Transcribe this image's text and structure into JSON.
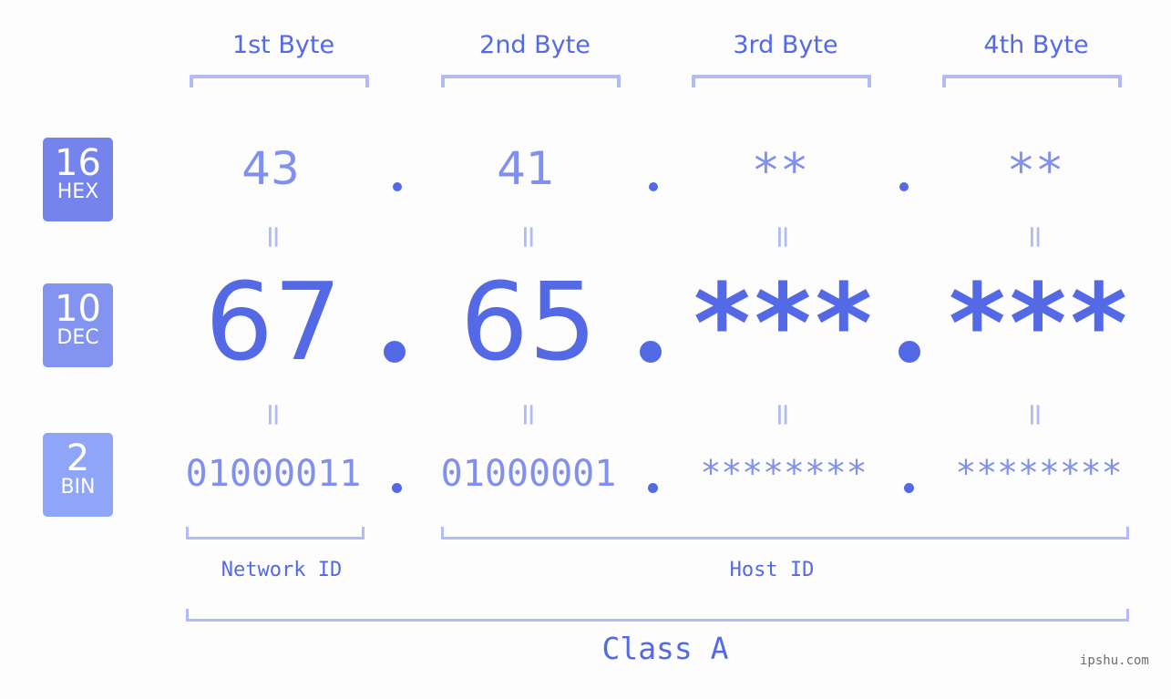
{
  "headers": [
    {
      "label": "1st Byte"
    },
    {
      "label": "2nd Byte"
    },
    {
      "label": "3rd Byte"
    },
    {
      "label": "4th Byte"
    }
  ],
  "badges": {
    "hex": {
      "num": "16",
      "label": "HEX",
      "color": "#7584ec"
    },
    "dec": {
      "num": "10",
      "label": "DEC",
      "color": "#8393f0"
    },
    "bin": {
      "num": "2",
      "label": "BIN",
      "color": "#8fa5f7"
    }
  },
  "hex_values": [
    "43",
    "41",
    "**",
    "**"
  ],
  "dec_values": [
    "67",
    "65",
    "***",
    "***"
  ],
  "bin_values": [
    "01000011",
    "01000001",
    "********",
    "********"
  ],
  "equals_sign": "=",
  "network_id_label": "Network ID",
  "host_id_label": "Host ID",
  "class_label": "Class A",
  "watermark": "ipshu.com",
  "colors": {
    "accent": "#5469e6",
    "light_value": "#8090ee",
    "bracket": "#b2bbf6",
    "background": "#fcfdfc"
  }
}
